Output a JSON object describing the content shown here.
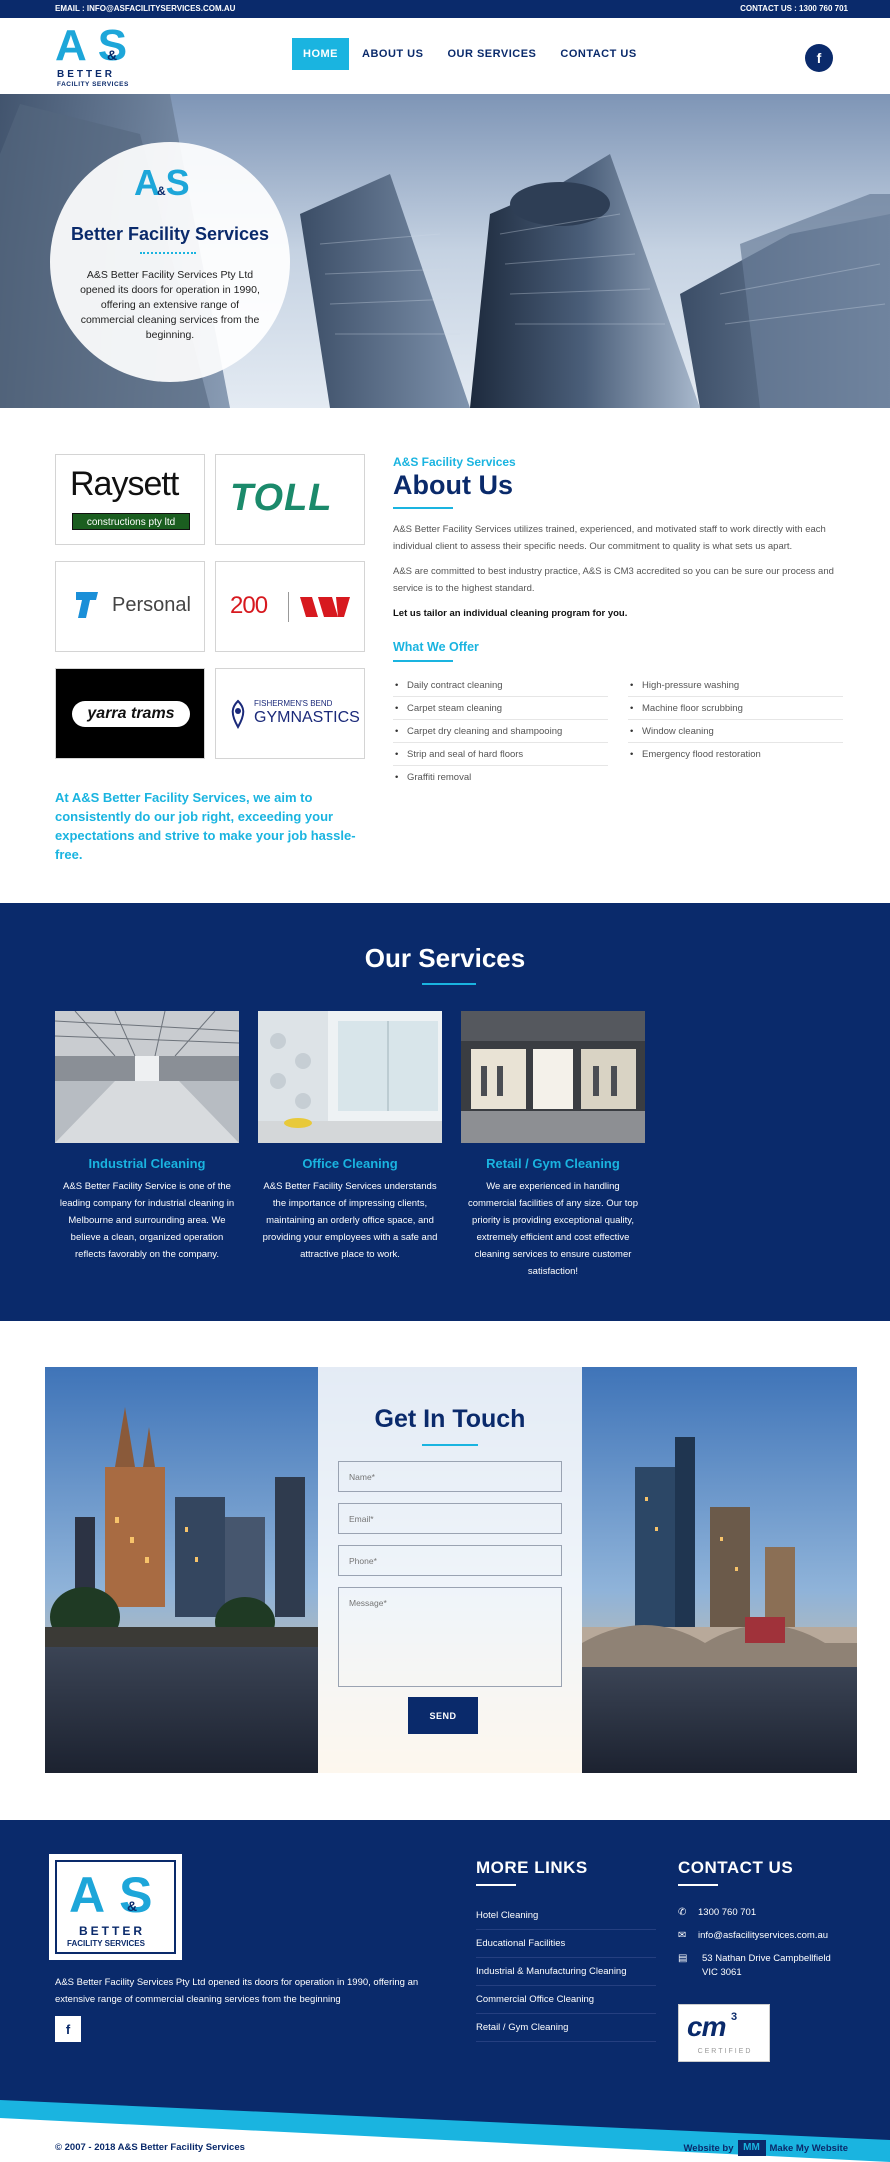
{
  "topbar": {
    "email": "EMAIL : INFO@ASFACILITYSERVICES.COM.AU",
    "phone": "CONTACT US : 1300 760 701"
  },
  "header": {
    "logo_big": "A&S",
    "logo_line1": "BETTER",
    "logo_line2": "FACILITY SERVICES",
    "nav": [
      {
        "label": "HOME",
        "active": true
      },
      {
        "label": "ABOUT US",
        "active": false
      },
      {
        "label": "OUR SERVICES",
        "active": false
      },
      {
        "label": "CONTACT US",
        "active": false
      }
    ],
    "social_icon": "facebook-icon"
  },
  "hero": {
    "title": "Better Facility Services",
    "text": "A&S Better Facility Services Pty Ltd opened its doors for operation in 1990, offering an extensive range of commercial cleaning services from the beginning."
  },
  "clients": [
    {
      "name": "Raysett",
      "sub": "constructions pty ltd"
    },
    {
      "name": "TOLL"
    },
    {
      "name": "Personal"
    },
    {
      "name": "200"
    },
    {
      "name": "yarra trams"
    },
    {
      "name": "FISHERMEN'S BEND",
      "sub": "GYMNASTICS"
    }
  ],
  "tagline": "At A&S Better Facility Services, we aim to consistently do our job right, exceeding your expectations and strive to make your job hassle-free.",
  "about": {
    "kicker": "A&S Facility Services",
    "title": "About Us",
    "p1": "A&S Better Facility Services utilizes trained, experienced, and motivated staff to work directly with each individual client to assess their specific needs. Our commitment to quality is what sets us apart.",
    "p2": "A&S are committed to best industry practice, A&S is CM3 accredited so you can be sure our process and service is to the highest standard.",
    "p3": "Let us tailor an individual cleaning program for you.",
    "offer_title": "What We Offer",
    "offer_left": [
      "Daily contract cleaning",
      "Carpet steam cleaning",
      "Carpet dry cleaning and shampooing",
      "Strip and seal of hard floors",
      "Graffiti removal"
    ],
    "offer_right": [
      "High-pressure washing",
      "Machine floor scrubbing",
      "Window cleaning",
      "Emergency flood restoration"
    ]
  },
  "services": {
    "title": "Our Services",
    "items": [
      {
        "title": "Industrial Cleaning",
        "text": "A&S Better Facility Service is one of the leading company for industrial cleaning in Melbourne and surrounding area. We believe a clean, organized operation reflects favorably on the company."
      },
      {
        "title": "Office Cleaning",
        "text": "A&S Better Facility Services understands the importance of impressing clients, maintaining an orderly office space, and providing your employees with a safe and attractive place to work."
      },
      {
        "title": "Retail / Gym Cleaning",
        "text": "We are experienced in handling commercial facilities of any size. Our top priority is providing exceptional quality, extremely efficient and cost effective cleaning services to ensure customer satisfaction!"
      }
    ]
  },
  "contact": {
    "title": "Get In Touch",
    "name_placeholder": "Name*",
    "email_placeholder": "Email*",
    "phone_placeholder": "Phone*",
    "message_placeholder": "Message*",
    "send": "SEND"
  },
  "footer": {
    "about": "A&S Better Facility Services Pty Ltd opened its doors for operation in 1990, offering an extensive range of commercial cleaning services from the beginning",
    "links_title": "MORE LINKS",
    "links": [
      "Hotel Cleaning",
      "Educational Facilities",
      "Industrial & Manufacturing Cleaning",
      "Commercial Office Cleaning",
      "Retail / Gym Cleaning"
    ],
    "contact_title": "CONTACT US",
    "phone": "1300 760 701",
    "email": "info@asfacilityservices.com.au",
    "address1": "53 Nathan Drive Campbellfield",
    "address2": "VIC 3061",
    "cert_main": "cm",
    "cert_sup": "3",
    "cert_label": "CERTIFIED",
    "copyright": "© 2007 - 2018 A&S Better Facility Services",
    "credit_pre": "Website by",
    "credit_mark": "MM",
    "credit_name": "Make My Website"
  }
}
